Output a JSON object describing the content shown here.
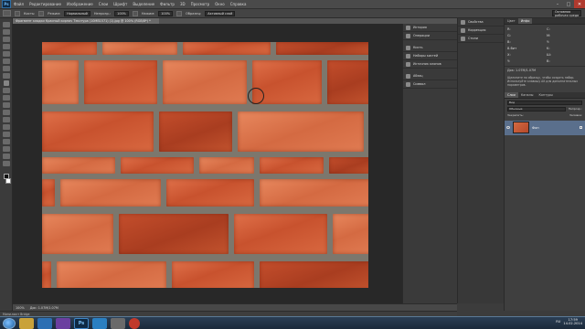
{
  "app": {
    "logo": "Ps"
  },
  "menu": [
    "Файл",
    "Редактирование",
    "Изображение",
    "Слои",
    "Шрифт",
    "Выделение",
    "Фильтр",
    "3D",
    "Просмотр",
    "Окно",
    "Справка"
  ],
  "window_controls": {
    "minimize": "–",
    "maximize": "□",
    "close": "✕"
  },
  "options": {
    "brush_label": "Кисть:",
    "mode_label": "Режим:",
    "mode_value": "Нормальный",
    "opacity_label": "Непрозр.:",
    "opacity_value": "100%",
    "pressure_label": "Нажим:",
    "pressure_value": "100%",
    "sample_label": "Образец:",
    "sample_value": "Активный слой",
    "workspace": "Основная рабочая среда"
  },
  "document": {
    "tab_title": "Фрагмент кладки Красный кирпич Текстура (10MB1571) (1).jpg @ 100% (RGB/8*) *"
  },
  "status": {
    "zoom": "100%",
    "doc_size": "Док: 1.07M/1.07M"
  },
  "mini_bridge": "Мини-мост Bridge",
  "panels_collapsed": [
    {
      "icon": "history-icon",
      "label": "История"
    },
    {
      "icon": "actions-icon",
      "label": "Операции"
    },
    {
      "icon": "brush-icon",
      "label": "Кисть"
    },
    {
      "icon": "brush-presets-icon",
      "label": "Наборы кистей"
    },
    {
      "icon": "clone-source-icon",
      "label": "Источник клонов"
    },
    {
      "icon": "paragraph-icon",
      "label": "Абзац"
    },
    {
      "icon": "character-icon",
      "label": "Символ"
    }
  ],
  "panels_col2": [
    {
      "icon": "properties-icon",
      "label": "Свойства"
    },
    {
      "icon": "adjustments-icon",
      "label": "Коррекция"
    },
    {
      "icon": "styles-icon",
      "label": "Стили"
    }
  ],
  "info_panel": {
    "tabs": [
      "Цвет",
      "Инфо"
    ],
    "active": "Инфо",
    "r": "R:",
    "g": "G:",
    "b": "B:",
    "c": "C:",
    "m": "M:",
    "y": "Y:",
    "k": "K:",
    "x": "X:",
    "y2": "Y:",
    "w": "Ш:",
    "h": "В:",
    "bitdepth": "8-бит",
    "doc": "Док: 1.07M/1.07M",
    "hint": "Щелкните по образцу, чтобы создать набор. Используйте клавишу Alt для дополнительных параметров."
  },
  "layers_panel": {
    "tabs": [
      "Слои",
      "Каналы",
      "Контуры"
    ],
    "active": "Слои",
    "kind": "Вид",
    "blend": "Обычные",
    "opacity_label": "Непрозр.:",
    "lock_label": "Закрепить:",
    "fill_label": "Заливка:",
    "layer_name": "Фон"
  },
  "taskbar": {
    "apps": [
      {
        "icon": "explorer-icon",
        "label": ""
      },
      {
        "icon": "media-player-icon",
        "label": ""
      },
      {
        "icon": "visual-studio-icon",
        "label": ""
      },
      {
        "icon": "photoshop-icon",
        "label": "Ps"
      },
      {
        "icon": "browser-icon",
        "label": ""
      },
      {
        "icon": "recorder-icon",
        "label": ""
      },
      {
        "icon": "app-icon",
        "label": ""
      }
    ],
    "lang": "RU",
    "time": "17:59",
    "date": "14.02.2014"
  },
  "colors": {
    "accent": "#5a6f8c",
    "brick": "#c8522e",
    "mortar": "#7c776d"
  }
}
